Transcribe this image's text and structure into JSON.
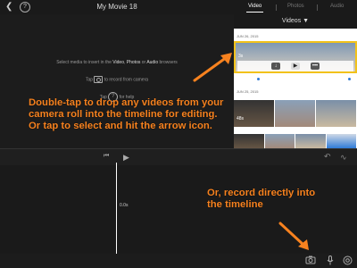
{
  "topbar": {
    "title": "My Movie 18",
    "back_icon": "chevron-left-icon",
    "help_label": "?"
  },
  "tabs": [
    {
      "label": "Video",
      "active": true
    },
    {
      "label": "Photos",
      "active": false
    },
    {
      "label": "Audio",
      "active": false
    }
  ],
  "viewer": {
    "hint_pre": "Select media to insert in the ",
    "hint_video": "Video",
    "hint_mid1": ", ",
    "hint_photos": "Photos",
    "hint_mid2": " or ",
    "hint_audio": "Audio",
    "hint_post": " browsers",
    "record_tap": "Tap",
    "record_rest": "to record from camera",
    "help_tap": "Tap",
    "help_rest": "for help"
  },
  "browser": {
    "header": "Videos ▼",
    "dates": [
      "JUN 26, 2015",
      "JUN 25, 2015"
    ],
    "durations": [
      "3s",
      "48s"
    ]
  },
  "annotations": {
    "main": "Double-tap to drop any videos from your camera roll into the timeline for editing. Or tap to select and hit the arrow icon.",
    "record": "Or, record directly into the timeline",
    "accent": "#f7821f"
  },
  "timeline": {
    "timecode": "0.0s"
  },
  "colors": {
    "selection": "#f2c21b",
    "background": "#1c1c1c"
  }
}
